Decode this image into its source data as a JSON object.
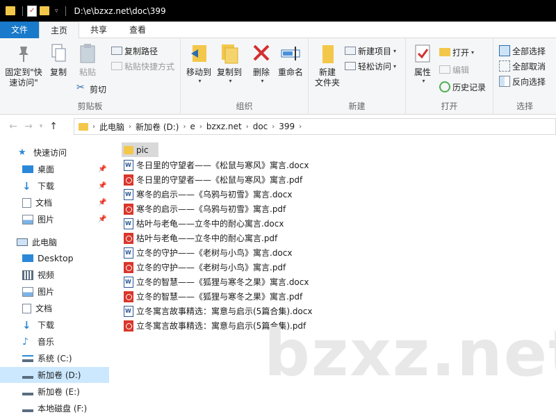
{
  "window": {
    "title_path": "D:\\e\\bzxz.net\\doc\\399"
  },
  "tabs": [
    {
      "label": "文件"
    },
    {
      "label": "主页"
    },
    {
      "label": "共享"
    },
    {
      "label": "查看"
    }
  ],
  "ribbon": {
    "clipboard": {
      "label": "剪贴板",
      "pin": "固定到\"快速访问\"",
      "copy": "复制",
      "paste": "粘贴",
      "copy_path": "复制路径",
      "paste_shortcut": "粘贴快捷方式",
      "cut": "剪切"
    },
    "organize": {
      "label": "组织",
      "move_to": "移动到",
      "copy_to": "复制到",
      "delete": "删除",
      "rename": "重命名"
    },
    "new": {
      "label": "新建",
      "new_folder": "新建\n文件夹",
      "new_item": "新建项目",
      "easy_access": "轻松访问"
    },
    "open": {
      "label": "打开",
      "properties": "属性",
      "open": "打开",
      "edit": "编辑",
      "history": "历史记录"
    },
    "select": {
      "label": "选择",
      "select_all": "全部选择",
      "select_none": "全部取消",
      "invert": "反向选择"
    }
  },
  "address": {
    "crumbs": [
      "此电脑",
      "新加卷 (D:)",
      "e",
      "bzxz.net",
      "doc",
      "399"
    ]
  },
  "sidebar": {
    "items": [
      {
        "label": "快速访问",
        "icon": "star-icon"
      },
      {
        "label": "桌面",
        "icon": "desktop-icon"
      },
      {
        "label": "下载",
        "icon": "download-icon"
      },
      {
        "label": "文档",
        "icon": "document-icon"
      },
      {
        "label": "图片",
        "icon": "picture-icon"
      },
      {
        "label": "此电脑",
        "icon": "computer-icon"
      },
      {
        "label": "Desktop",
        "icon": "desktop-icon"
      },
      {
        "label": "视频",
        "icon": "video-icon"
      },
      {
        "label": "图片",
        "icon": "picture-icon"
      },
      {
        "label": "文档",
        "icon": "document-icon"
      },
      {
        "label": "下载",
        "icon": "download-icon"
      },
      {
        "label": "音乐",
        "icon": "music-icon"
      },
      {
        "label": "系统 (C:)",
        "icon": "drive-icon"
      },
      {
        "label": "新加卷 (D:)",
        "icon": "drive-icon"
      },
      {
        "label": "新加卷 (E:)",
        "icon": "drive-icon"
      },
      {
        "label": "本地磁盘 (F:)",
        "icon": "drive-icon"
      }
    ]
  },
  "files": [
    {
      "name": "pic",
      "type": "folder"
    },
    {
      "name": "冬日里的守望者——《松鼠与寒风》寓言.docx",
      "type": "docx"
    },
    {
      "name": "冬日里的守望者——《松鼠与寒风》寓言.pdf",
      "type": "pdf"
    },
    {
      "name": "寒冬的启示——《乌鸦与初雪》寓言.docx",
      "type": "docx"
    },
    {
      "name": "寒冬的启示——《乌鸦与初雪》寓言.pdf",
      "type": "pdf"
    },
    {
      "name": "枯叶与老龟——立冬中的耐心寓言.docx",
      "type": "docx"
    },
    {
      "name": "枯叶与老龟——立冬中的耐心寓言.pdf",
      "type": "pdf"
    },
    {
      "name": "立冬的守护——《老树与小鸟》寓言.docx",
      "type": "docx"
    },
    {
      "name": "立冬的守护——《老树与小鸟》寓言.pdf",
      "type": "pdf"
    },
    {
      "name": "立冬的智慧——《狐狸与寒冬之果》寓言.docx",
      "type": "docx"
    },
    {
      "name": "立冬的智慧——《狐狸与寒冬之果》寓言.pdf",
      "type": "pdf"
    },
    {
      "name": "立冬寓言故事精选：寓意与启示(5篇合集).docx",
      "type": "docx"
    },
    {
      "name": "立冬寓言故事精选：寓意与启示(5篇合集).pdf",
      "type": "pdf"
    }
  ],
  "watermark": "bzxz.net",
  "colors": {
    "accent": "#1979ca",
    "selection": "#cce8ff",
    "folder": "#f3c74a",
    "pdf": "#d9362c"
  }
}
